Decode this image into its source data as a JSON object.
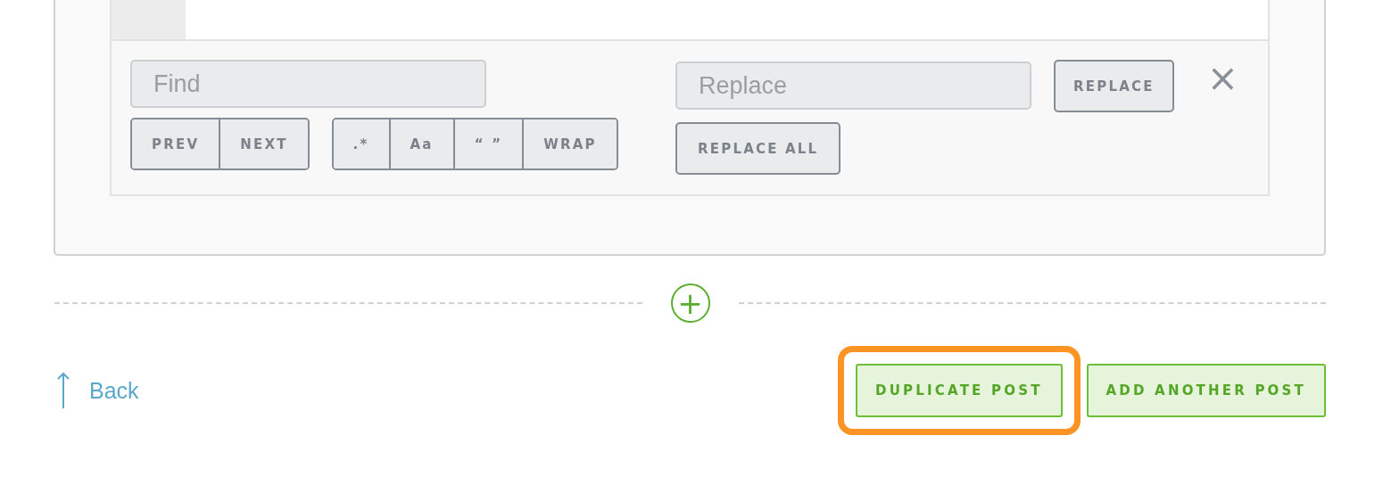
{
  "find_bar": {
    "find_field": {
      "placeholder": "Find"
    },
    "replace_field": {
      "placeholder": "Replace"
    },
    "nav_buttons": [
      "PREV",
      "NEXT"
    ],
    "option_buttons": [
      ".*",
      "Aa",
      "“ ”",
      "WRAP"
    ],
    "replace_button": "REPLACE",
    "replace_all_button": "REPLACE ALL",
    "close": "×"
  },
  "add_block": {
    "label": "+"
  },
  "footer": {
    "back_link": "Back",
    "buttons": [
      {
        "label": "DUPLICATE POST",
        "highlighted": true
      },
      {
        "label": "ADD ANOTHER POST",
        "highlighted": false
      }
    ]
  }
}
